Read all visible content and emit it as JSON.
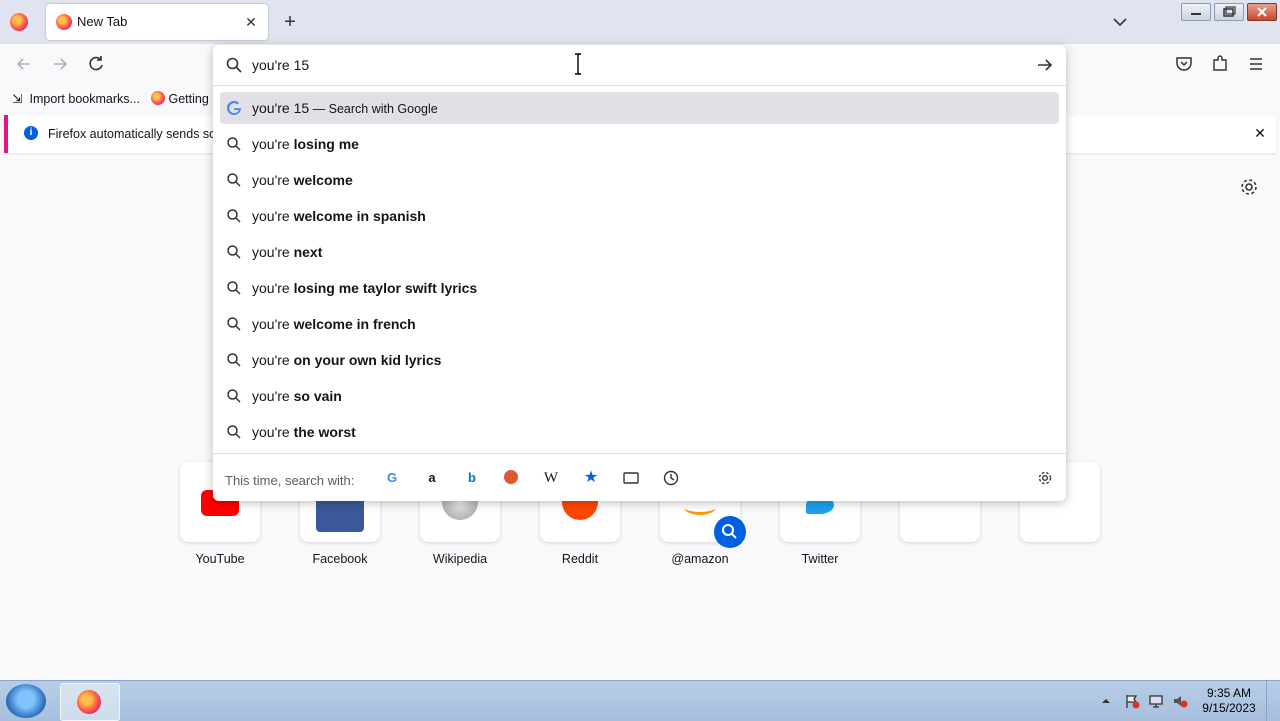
{
  "browser": {
    "tab_title": "New Tab",
    "tab_close_icon": "close-icon",
    "new_tab_icon": "plus-icon"
  },
  "bookmarks": {
    "import_label": "Import bookmarks...",
    "getting_label": "Getting"
  },
  "notice": {
    "text": "Firefox automatically sends som"
  },
  "urlbar": {
    "value": "you're 15",
    "results": [
      {
        "prefix": "you're 15",
        "bold": "",
        "suffix": "Search with Google",
        "icon": "google-icon",
        "selected": true
      },
      {
        "prefix": "you're ",
        "bold": "losing me",
        "icon": "search-icon"
      },
      {
        "prefix": "you're ",
        "bold": "welcome",
        "icon": "search-icon"
      },
      {
        "prefix": "you're ",
        "bold": "welcome in spanish",
        "icon": "search-icon"
      },
      {
        "prefix": "you're ",
        "bold": "next",
        "icon": "search-icon"
      },
      {
        "prefix": "you're ",
        "bold": "losing me taylor swift lyrics",
        "icon": "search-icon"
      },
      {
        "prefix": "you're ",
        "bold": "welcome in french",
        "icon": "search-icon"
      },
      {
        "prefix": "you're ",
        "bold": "on your own kid lyrics",
        "icon": "search-icon"
      },
      {
        "prefix": "you're ",
        "bold": "so vain",
        "icon": "search-icon"
      },
      {
        "prefix": "you're ",
        "bold": "the worst",
        "icon": "search-icon"
      }
    ],
    "oneoff_label": "This time, search with:",
    "engines": [
      "google",
      "amazon",
      "bing",
      "duckduckgo",
      "wikipedia",
      "bookmarks",
      "tabs",
      "history"
    ]
  },
  "top_sites": [
    {
      "label": "YouTube"
    },
    {
      "label": "Facebook"
    },
    {
      "label": "Wikipedia"
    },
    {
      "label": "Reddit"
    },
    {
      "label": "@amazon"
    },
    {
      "label": "Twitter"
    },
    {
      "label": ""
    },
    {
      "label": ""
    }
  ],
  "taskbar": {
    "time": "9:35 AM",
    "date": "9/15/2023"
  }
}
